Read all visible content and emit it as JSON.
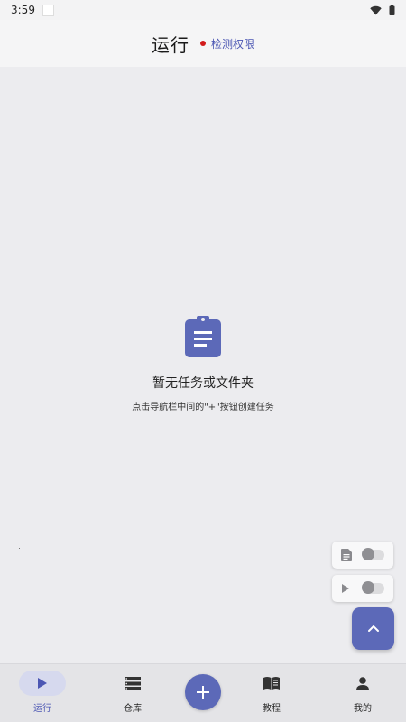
{
  "status_bar": {
    "time": "3:59"
  },
  "header": {
    "title": "运行",
    "permission_link": "检测权限"
  },
  "empty_state": {
    "title": "暂无任务或文件夹",
    "subtitle": "点击导航栏中间的\"+\"按钮创建任务"
  },
  "nav": {
    "items": [
      {
        "label": "运行",
        "icon": "play-icon",
        "active": true
      },
      {
        "label": "仓库",
        "icon": "storage-icon",
        "active": false
      },
      {
        "label": "教程",
        "icon": "book-icon",
        "active": false
      },
      {
        "label": "我的",
        "icon": "person-icon",
        "active": false
      }
    ],
    "add_icon": "plus-icon"
  },
  "colors": {
    "accent": "#5c69b8",
    "link": "#4b56b3",
    "red_dot": "#d21b1b",
    "background": "#ececef"
  }
}
